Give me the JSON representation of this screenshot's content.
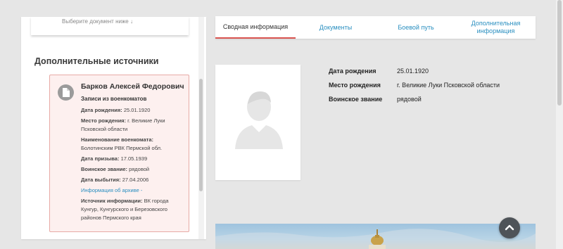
{
  "left_panel": {
    "top_hint": "Выберите документ ниже ↓",
    "sources_heading": "Дополнительные источники",
    "record": {
      "name": "Барков Алексей Федорович",
      "type": "Записи из военкоматов",
      "birth_date_label": "Дата рождения:",
      "birth_date": "25.01.1920",
      "birth_place_label": "Место рождения:",
      "birth_place": "г. Великие Луки Псковской области",
      "commissariat_label": "Наименование военкомата:",
      "commissariat": "Болотинским РВК Пермской обл.",
      "draft_date_label": "Дата призыва:",
      "draft_date": "17.05.1939",
      "rank_label": "Воинское звание:",
      "rank": "рядовой",
      "departure_date_label": "Дата выбытия:",
      "departure_date": "27.04.2006",
      "archive_link": "Информация об архиве -",
      "source_label": "Источник информации:",
      "source": "ВК города Кунгур, Кунгурского и Березовского районов Пермского края"
    }
  },
  "tabs": [
    {
      "label": "Сводная информация",
      "active": true
    },
    {
      "label": "Документы",
      "active": false
    },
    {
      "label": "Боевой путь",
      "active": false
    },
    {
      "label": "Дополнительная информация",
      "active": false
    }
  ],
  "profile": {
    "birth_date_label": "Дата рождения",
    "birth_date": "25.01.1920",
    "birth_place_label": "Место рождения",
    "birth_place": "г. Великие Луки Псковской области",
    "rank_label": "Воинское звание",
    "rank": "рядовой"
  },
  "icons": {
    "document": "document-icon",
    "avatar": "person-silhouette-icon",
    "scroll_top": "chevron-up-icon"
  },
  "colors": {
    "accent_red": "#d9534f",
    "link_blue": "#2a8fc0",
    "card_bg": "#fdf0ef",
    "card_border": "#e7aaa6"
  }
}
